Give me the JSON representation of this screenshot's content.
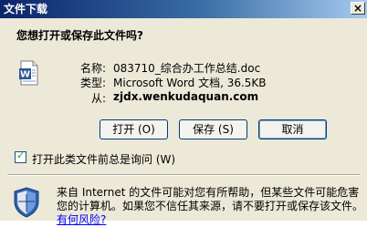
{
  "dialog": {
    "title": "文件下载",
    "close_label": "×",
    "question": "您想打开或保存此文件吗?"
  },
  "file": {
    "icon": "word-document-icon",
    "name_label": "名称:",
    "name_value": "083710_综合办工作总结.doc",
    "type_label": "类型:",
    "type_value": "Microsoft Word 文档, 36.5KB",
    "from_label": "从:",
    "from_value": "zjdx.wenkudaquan.com"
  },
  "buttons": {
    "open": "打开 (O)",
    "save": "保存 (S)",
    "cancel": "取消"
  },
  "checkbox": {
    "label": "打开此类文件前总是询问 (W)",
    "checked": true
  },
  "warning": {
    "icon": "security-shield-icon",
    "text": "来自 Internet 的文件可能对您有所帮助，但某些文件可能危害您的计算机。如果您不信任其来源，请不要打开或保存该文件。",
    "link": "有何风险?"
  },
  "colors": {
    "title_start": "#0a246a",
    "title_end": "#a6caf0",
    "dialog_bg": "#ece9d8",
    "link": "#0000ff"
  }
}
